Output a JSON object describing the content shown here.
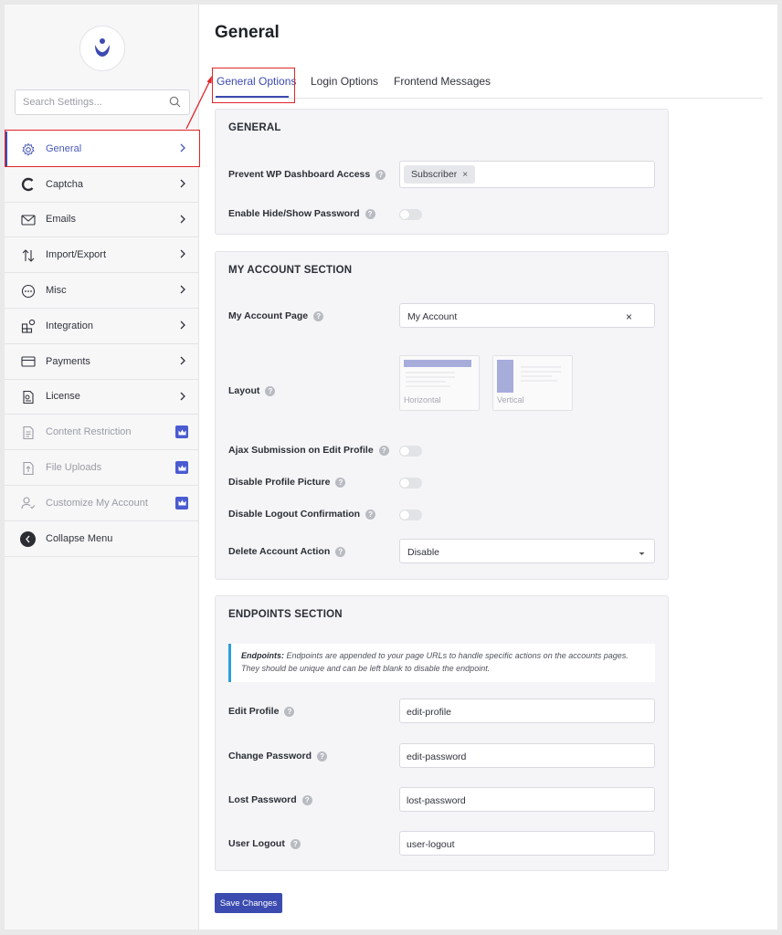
{
  "sidebar": {
    "search_placeholder": "Search Settings...",
    "items": [
      {
        "label": "General"
      },
      {
        "label": "Captcha"
      },
      {
        "label": "Emails"
      },
      {
        "label": "Import/Export"
      },
      {
        "label": "Misc"
      },
      {
        "label": "Integration"
      },
      {
        "label": "Payments"
      },
      {
        "label": "License"
      },
      {
        "label": "Content Restriction"
      },
      {
        "label": "File Uploads"
      },
      {
        "label": "Customize My Account"
      },
      {
        "label": "Collapse Menu"
      }
    ]
  },
  "header": {
    "title": "General",
    "tabs": [
      {
        "label": "General Options"
      },
      {
        "label": "Login Options"
      },
      {
        "label": "Frontend Messages"
      }
    ]
  },
  "general_section": {
    "title": "GENERAL",
    "prevent_label": "Prevent WP Dashboard Access",
    "prevent_tag": "Subscriber",
    "prevent_tag_remove": "×",
    "hide_show_label": "Enable Hide/Show Password"
  },
  "account_section": {
    "title": "MY ACCOUNT SECTION",
    "page_label": "My Account Page",
    "page_value": "My Account",
    "page_clear": "×",
    "layout_label": "Layout",
    "layout_horizontal": "Horizontal",
    "layout_vertical": "Vertical",
    "ajax_label": "Ajax Submission on Edit Profile",
    "disable_picture_label": "Disable Profile Picture",
    "disable_logout_label": "Disable Logout Confirmation",
    "delete_label": "Delete Account Action",
    "delete_value": "Disable"
  },
  "endpoints_section": {
    "title": "ENDPOINTS SECTION",
    "info_bold": "Endpoints:",
    "info_text": " Endpoints are appended to your page URLs to handle specific actions on the accounts pages. They should be unique and can be left blank to disable the endpoint.",
    "fields": [
      {
        "label": "Edit Profile",
        "value": "edit-profile"
      },
      {
        "label": "Change Password",
        "value": "edit-password"
      },
      {
        "label": "Lost Password",
        "value": "lost-password"
      },
      {
        "label": "User Logout",
        "value": "user-logout"
      }
    ]
  },
  "save_label": "Save Changes",
  "help_glyph": "?",
  "colors": {
    "accent": "#3b4bb0",
    "highlight": "#e0252a",
    "info_border": "#2d9fd9"
  }
}
